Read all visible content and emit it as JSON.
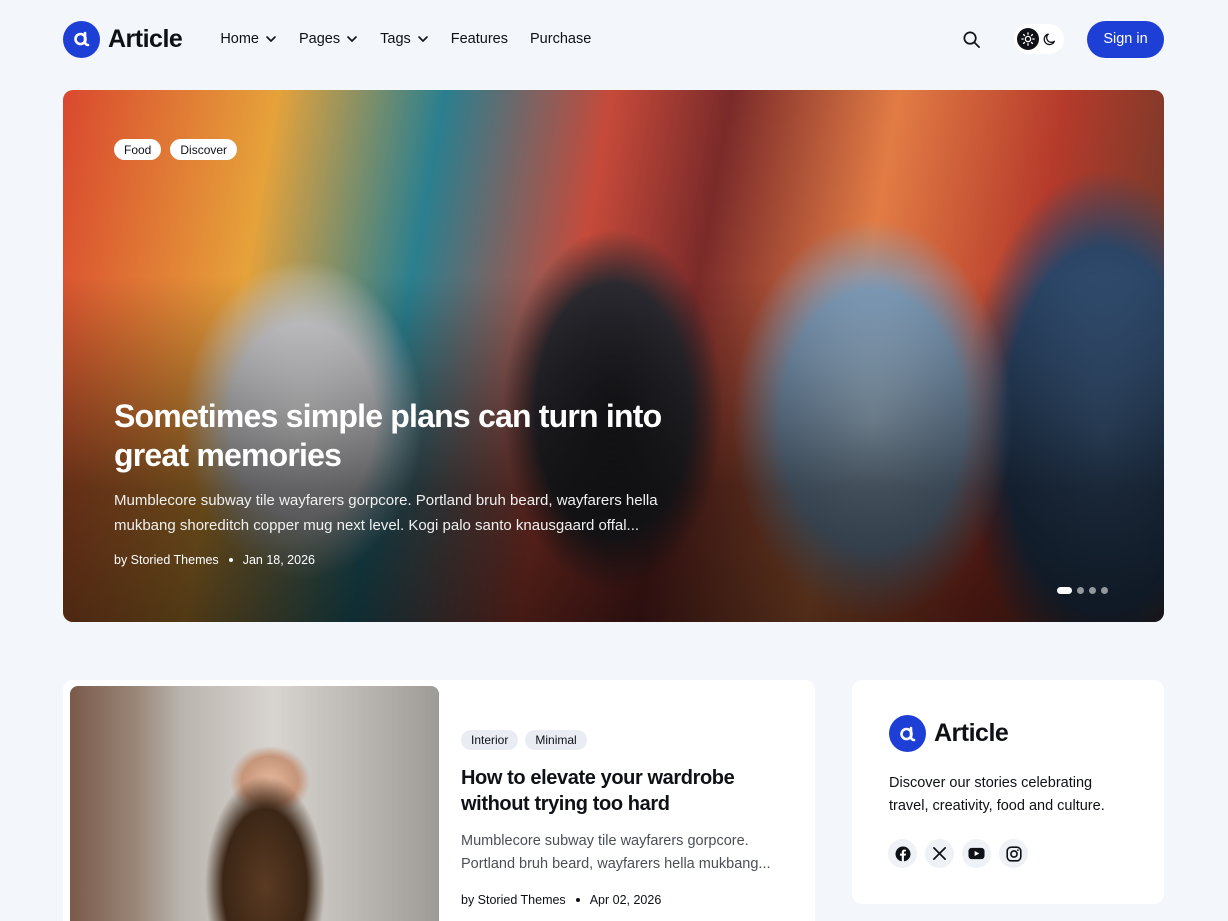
{
  "brand": {
    "name": "Article"
  },
  "nav": {
    "items": [
      {
        "label": "Home",
        "has_dropdown": true
      },
      {
        "label": "Pages",
        "has_dropdown": true
      },
      {
        "label": "Tags",
        "has_dropdown": true
      },
      {
        "label": "Features",
        "has_dropdown": false
      },
      {
        "label": "Purchase",
        "has_dropdown": false
      }
    ]
  },
  "header": {
    "signin_label": "Sign in",
    "theme_active": "light"
  },
  "hero": {
    "tags": [
      "Food",
      "Discover"
    ],
    "title": "Sometimes simple plans can turn into great memories",
    "excerpt": "Mumblecore subway tile wayfarers gorpcore. Portland bruh beard, wayfarers hella mukbang shoreditch copper mug next level. Kogi palo santo knausgaard offal...",
    "author": "by Storied Themes",
    "date": "Jan 18, 2026",
    "slides_count": 4,
    "active_slide": 1
  },
  "post": {
    "tags": [
      "Interior",
      "Minimal"
    ],
    "title": "How to elevate your wardrobe without trying too hard",
    "excerpt": "Mumblecore subway tile wayfarers gorpcore. Portland bruh beard, wayfarers hella mukbang...",
    "author": "by Storied Themes",
    "date": "Apr 02, 2026"
  },
  "widget": {
    "brand": "Article",
    "description": "Discover our stories celebrating travel, creativity, food and culture.",
    "socials": [
      "facebook-icon",
      "x-icon",
      "youtube-icon",
      "instagram-icon"
    ]
  },
  "colors": {
    "accent": "#1d3fd6",
    "background": "#f3f6fb",
    "text": "#0e1116"
  }
}
